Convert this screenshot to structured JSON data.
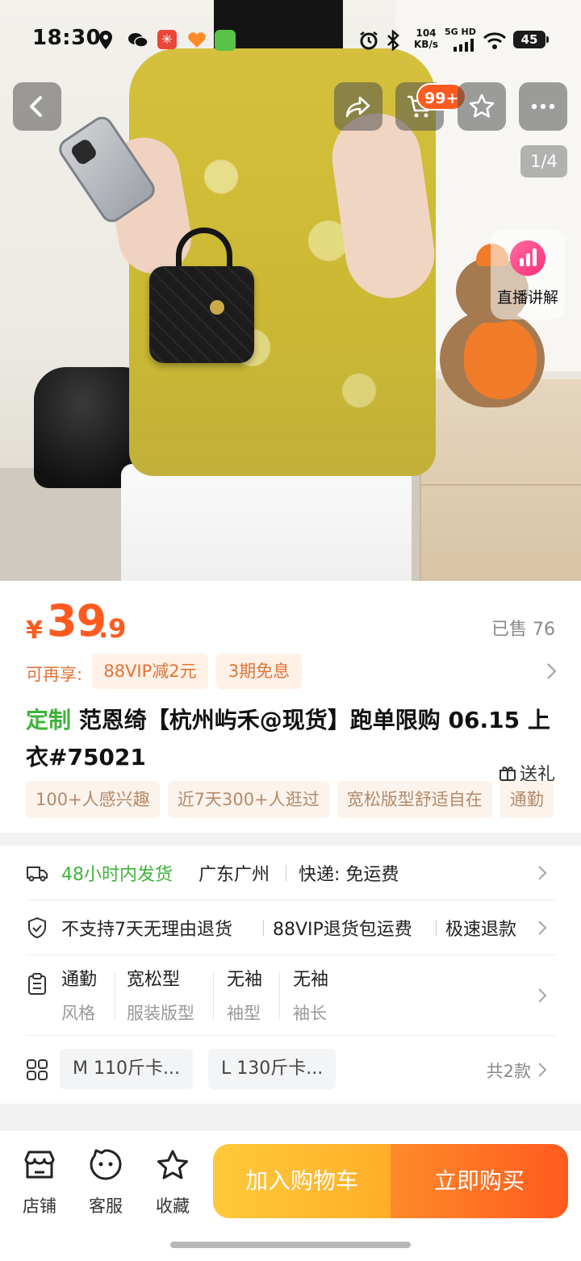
{
  "status_bar": {
    "time": "18:30",
    "app_badge": "✳",
    "net_speed_value": "104",
    "net_speed_unit": "KB/s",
    "network": "5G HD",
    "battery": "45"
  },
  "gallery": {
    "cart_badge": "99+",
    "page_indicator": "1/4",
    "live_label": "直播讲解"
  },
  "product": {
    "currency": "¥",
    "price_int": "39",
    "price_dec": ".9",
    "sold": "已售 76",
    "promo_lead": "可再享:",
    "promos": [
      "88VIP减2元",
      "3期免息"
    ],
    "title_tag": "定制",
    "title": " 范恩绮【杭州屿禾@现货】跑单限购 06.15 上衣#75021",
    "gift": "送礼",
    "chips": [
      "100+人感兴趣",
      "近7天300+人逛过",
      "宽松版型舒适自在",
      "通勤"
    ]
  },
  "details": {
    "shipping_time": "48小时内发货",
    "ship_from": "广东广州",
    "delivery": "快递: 免运费",
    "service": [
      "不支持7天无理由退货",
      "88VIP退货包运费",
      "极速退款"
    ],
    "attributes": [
      {
        "value": "通勤",
        "label": "风格"
      },
      {
        "value": "宽松型",
        "label": "服装版型"
      },
      {
        "value": "无袖",
        "label": "袖型"
      },
      {
        "value": "无袖",
        "label": "袖长"
      }
    ],
    "skus": [
      "M 110斤卡...",
      "L 130斤卡..."
    ],
    "sku_count": "共2款"
  },
  "bottom_bar": {
    "shop": "店铺",
    "service": "客服",
    "collect": "收藏",
    "add_to_cart": "加入购物车",
    "buy_now": "立即购买"
  },
  "colors": {
    "price": "#ff5a1f",
    "green_tag": "#3fb33a",
    "cta_cart": "#ffae2a",
    "cta_buy": "#ff5a1f"
  },
  "icons": [
    "location-icon",
    "wechat-icon",
    "alarm-icon",
    "bluetooth-icon",
    "wifi-icon",
    "back-icon",
    "share-icon",
    "cart-icon",
    "star-icon",
    "more-icon",
    "live-icon",
    "gift-icon",
    "truck-icon",
    "shield-icon",
    "clipboard-icon",
    "grid-icon",
    "shop-icon",
    "service-icon",
    "chevron-right-icon"
  ]
}
